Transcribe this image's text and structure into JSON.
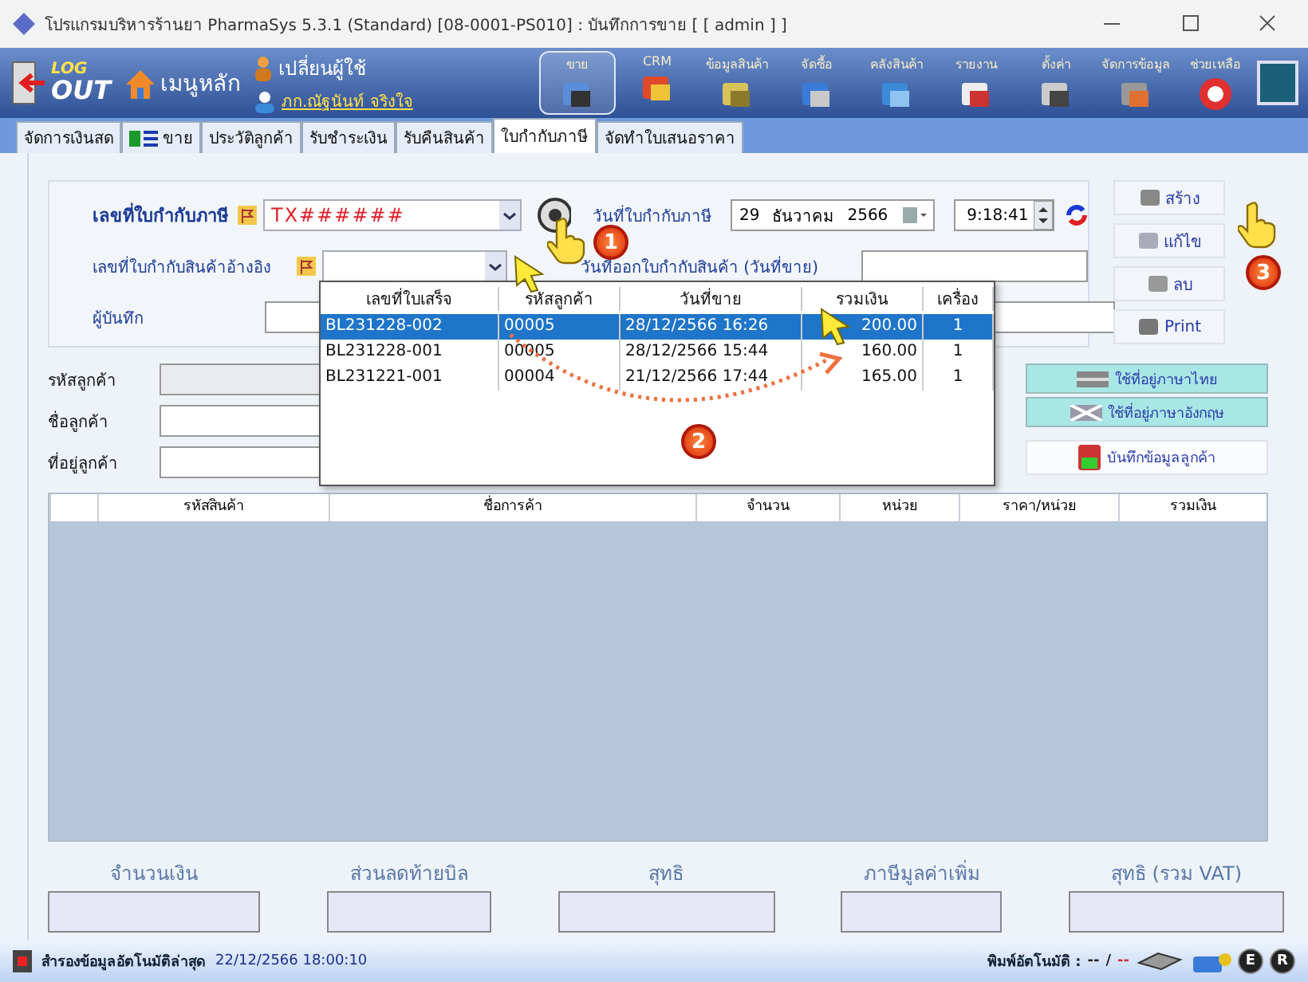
{
  "window": {
    "title": "โปรแกรมบริหารร้านยา PharmaSys 5.3.1 (Standard) [08-0001-PS010] : บันทึกการขาย  [ [ admin ] ]"
  },
  "toolbar": {
    "logout": {
      "line1": "LOG",
      "line2": "OUT"
    },
    "home": "เมนูหลัก",
    "switch_user": "เปลี่ยนผู้ใช้",
    "user": "ภก.ณัฐนันท์ จริงใจ",
    "modules": [
      {
        "label": "ขาย",
        "kind": "sale",
        "selected": true
      },
      {
        "label": "CRM",
        "kind": "crm",
        "selected": false
      },
      {
        "label": "ข้อมูลสินค้า",
        "kind": "product",
        "selected": false
      },
      {
        "label": "จัดซื้อ",
        "kind": "purchase",
        "selected": false
      },
      {
        "label": "คลังสินค้า",
        "kind": "stock",
        "selected": false
      },
      {
        "label": "รายงาน",
        "kind": "report",
        "selected": false
      },
      {
        "label": "ตั้งค่า",
        "kind": "settings",
        "selected": false
      },
      {
        "label": "จัดการข้อมูล",
        "kind": "data",
        "selected": false
      },
      {
        "label": "ช่วยเหลือ",
        "kind": "help",
        "selected": false
      }
    ]
  },
  "tabs": [
    {
      "label": "จัดการเงินสด",
      "kind": "plain",
      "selected": false
    },
    {
      "label": "ขาย",
      "kind": "icon",
      "selected": false
    },
    {
      "label": "ประวัติลูกค้า",
      "kind": "plain",
      "selected": false
    },
    {
      "label": "รับชำระเงิน",
      "kind": "plain",
      "selected": false
    },
    {
      "label": "รับคืนสินค้า",
      "kind": "plain",
      "selected": false
    },
    {
      "label": "ใบกำกับภาษี",
      "kind": "plain",
      "selected": true
    },
    {
      "label": "จัดทำใบเสนอราคา",
      "kind": "plain",
      "selected": false
    }
  ],
  "form": {
    "tax_invoice_no": {
      "label": "เลขที่ใบกำกับภาษี",
      "value": "TX######"
    },
    "ref_invoice": {
      "label": "เลขที่ใบกำกับสินค้าอ้างอิง"
    },
    "recorder": {
      "label": "ผู้บันทึก"
    },
    "tax_date": {
      "label": "วันที่ใบกำกับภาษี",
      "day": "29",
      "month": "ธันวาคม",
      "year": "2566",
      "time": "9:18:41"
    },
    "sale_date": {
      "label": "วันที่ออกใบกำกับสินค้า (วันที่ขาย)"
    }
  },
  "actions": [
    {
      "label": "สร้าง",
      "kind": "create"
    },
    {
      "label": "แก้ไข",
      "kind": "edit"
    },
    {
      "label": "ลบ",
      "kind": "delete"
    },
    {
      "label": "Print",
      "kind": "print"
    }
  ],
  "customer": {
    "fields": [
      {
        "label": "รหัสลูกค้า",
        "kind": "readonly"
      },
      {
        "label": "ชื่อลูกค้า",
        "kind": "input"
      },
      {
        "label": "ที่อยู่ลูกค้า",
        "kind": "input"
      }
    ],
    "buttons": [
      {
        "label": "ใช้ที่อยู่ภาษาไทย",
        "kind": "thai"
      },
      {
        "label": "ใช้ที่อยู่ภาษาอังกฤษ",
        "kind": "english"
      },
      {
        "label": "บันทึกข้อมูลลูกค้า",
        "kind": "save"
      }
    ]
  },
  "items_table": {
    "columns": [
      "รหัสสินค้า",
      "ชื่อการค้า",
      "จำนวน",
      "หน่วย",
      "ราคา/หน่วย",
      "รวมเงิน"
    ]
  },
  "totals": [
    "จำนวนเงิน",
    "ส่วนลดท้ายบิล",
    "สุทธิ",
    "ภาษีมูลค่าเพิ่ม",
    "สุทธิ (รวม VAT)"
  ],
  "dropdown": {
    "columns": [
      "เลขที่ใบเสร็จ",
      "รหัสลูกค้า",
      "วันที่ขาย",
      "รวมเงิน",
      "เครื่อง"
    ],
    "rows": [
      {
        "cells": [
          "BL231228-002",
          "00005",
          "28/12/2566 16:26",
          "200.00",
          "1"
        ],
        "selected": true
      },
      {
        "cells": [
          "BL231228-001",
          "00005",
          "28/12/2566 15:44",
          "160.00",
          "1"
        ],
        "selected": false
      },
      {
        "cells": [
          "BL231221-001",
          "00004",
          "21/12/2566 17:44",
          "165.00",
          "1"
        ],
        "selected": false
      }
    ]
  },
  "annotations": [
    "1",
    "2",
    "3"
  ],
  "status_bar": {
    "backup_label": "สำรองข้อมูลอัตโนมัติล่าสุด",
    "backup_time": "22/12/2566 18:00:10",
    "auto_print_label": "พิมพ์อัตโนมัติ :",
    "auto_print_values": [
      "--",
      "/",
      "--"
    ],
    "badges": [
      "E",
      "R"
    ]
  }
}
